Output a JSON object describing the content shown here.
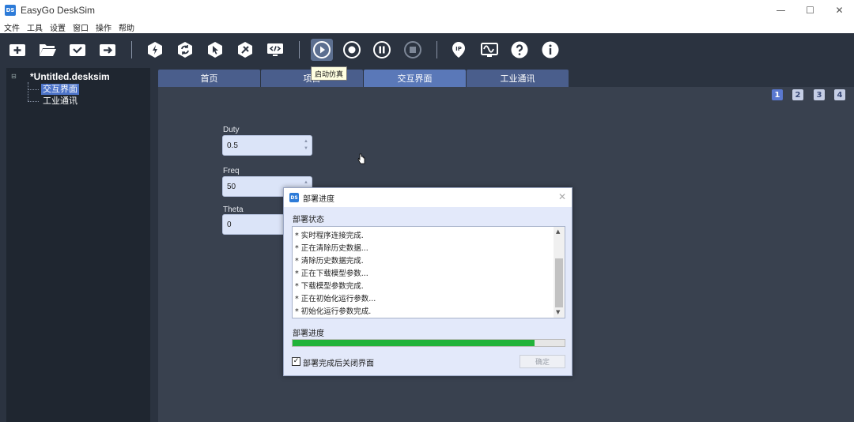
{
  "window": {
    "app_icon_text": "DS",
    "title": "EasyGo DeskSim",
    "controls": {
      "minimize": "—",
      "maximize": "☐",
      "close": "✕"
    }
  },
  "menu": [
    "文件",
    "工具",
    "设置",
    "窗口",
    "操作",
    "帮助"
  ],
  "toolbar": {
    "tooltip": "启动仿真",
    "ip_label": "IP"
  },
  "sidebar": {
    "root": "*Untitled.desksim",
    "children": [
      "交互界面",
      "工业通讯"
    ]
  },
  "tabs": [
    "首页",
    "项目",
    "交互界面",
    "工业通讯"
  ],
  "active_tab": "交互界面",
  "pages": [
    "1",
    "2",
    "3",
    "4"
  ],
  "fields": [
    {
      "label": "Duty",
      "value": "0.5"
    },
    {
      "label": "Freq",
      "value": "50"
    },
    {
      "label": "Theta",
      "value": "0"
    }
  ],
  "dialog": {
    "icon_text": "DS",
    "title": "部署进度",
    "status_heading": "部署状态",
    "log": [
      "* 实时程序连接完成.",
      "* 正在清除历史数据...",
      "* 清除历史数据完成.",
      "* 正在下载模型参数...",
      "* 下载模型参数完成.",
      "* 正在初始化运行参数...",
      "* 初始化运行参数完成."
    ],
    "progress_heading": "部署进度",
    "progress_fraction": 0.89,
    "checkbox_label": "部署完成后关闭界面",
    "checkbox_checked": true,
    "ok_label": "确定"
  },
  "colors": {
    "background": "#2b3340",
    "tab": "#4a5e8c",
    "tab_active": "#5a78b8",
    "selected": "#4d74c9",
    "progress": "#21b33a"
  }
}
